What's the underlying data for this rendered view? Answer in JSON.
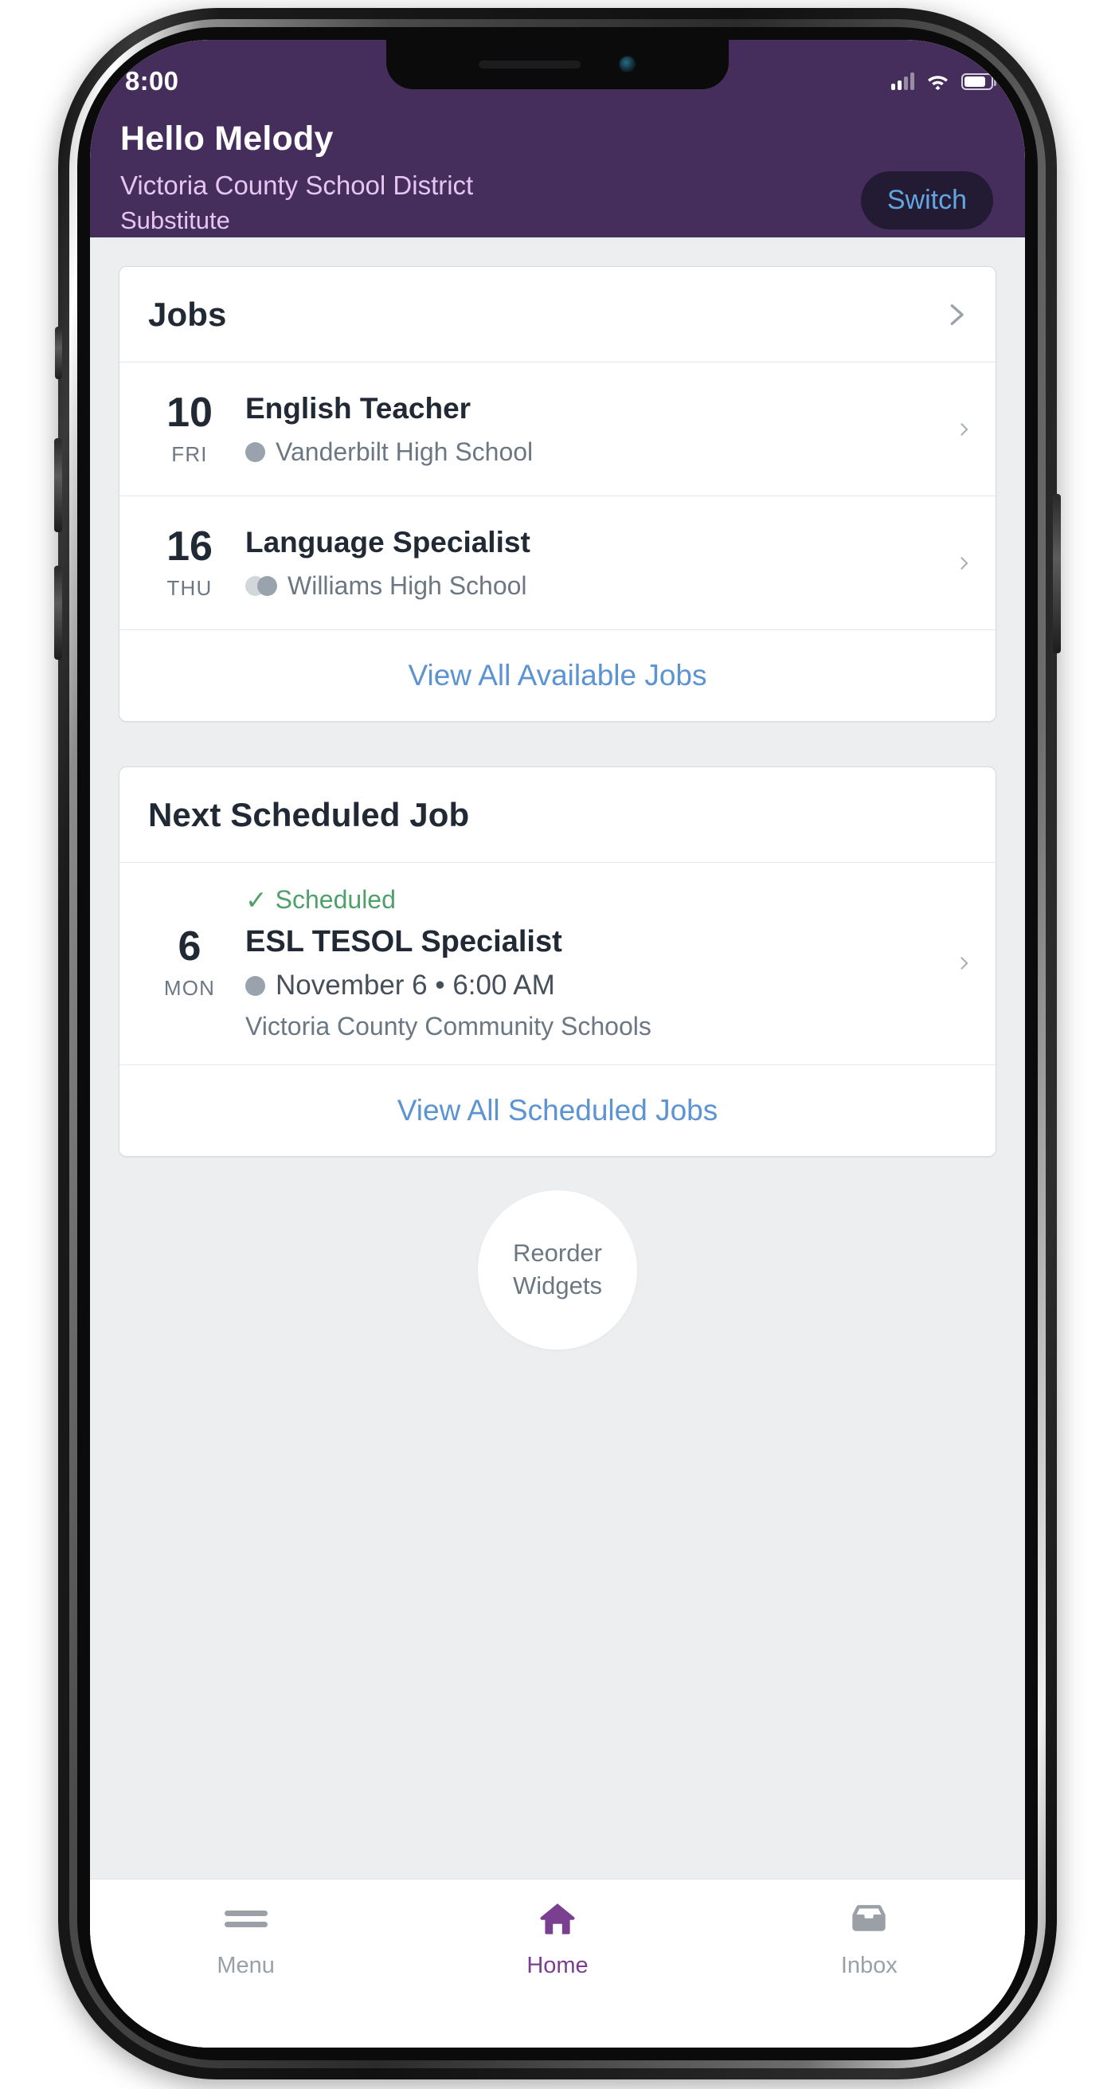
{
  "status_bar": {
    "time": "8:00",
    "icons": [
      "cellular-signal-icon",
      "wifi-icon",
      "battery-icon"
    ]
  },
  "header": {
    "greeting": "Hello Melody",
    "district": "Victoria County School District",
    "role": "Substitute",
    "switch_label": "Switch",
    "background_color": "#452e5c",
    "accent_color": "#62a6e0"
  },
  "jobs_card": {
    "title": "Jobs",
    "chevron": "chevron-right-icon",
    "rows": [
      {
        "day": "10",
        "weekday": "FRI",
        "title": "English Teacher",
        "school": "Vanderbilt High School",
        "indicator": "single-day-dot",
        "chevron": "chevron-right-icon"
      },
      {
        "day": "16",
        "weekday": "THU",
        "title": "Language Specialist",
        "school": "Williams High School",
        "indicator": "multi-day-dot",
        "chevron": "chevron-right-icon"
      }
    ],
    "link_label": "View All Available Jobs",
    "link_color": "#5b93d3"
  },
  "next_scheduled_card": {
    "title": "Next Scheduled Job",
    "entry": {
      "day": "6",
      "weekday": "MON",
      "status": "Scheduled",
      "status_icon": "check-icon",
      "status_color": "#4fa06b",
      "title": "ESL TESOL Specialist",
      "when": "November 6 • 6:00 AM",
      "organization": "Victoria County Community Schools",
      "indicator": "single-day-dot",
      "chevron": "chevron-right-icon"
    },
    "link_label": "View All Scheduled Jobs",
    "link_color": "#5b93d3"
  },
  "reorder_widgets": {
    "line1": "Reorder",
    "line2": "Widgets"
  },
  "tab_bar": {
    "active_color": "#7b3f8f",
    "inactive_color": "#9aa0a6",
    "tabs": [
      {
        "label": "Menu",
        "icon": "hamburger-menu-icon",
        "active": false
      },
      {
        "label": "Home",
        "icon": "home-icon",
        "active": true
      },
      {
        "label": "Inbox",
        "icon": "inbox-tray-icon",
        "active": false
      }
    ]
  }
}
